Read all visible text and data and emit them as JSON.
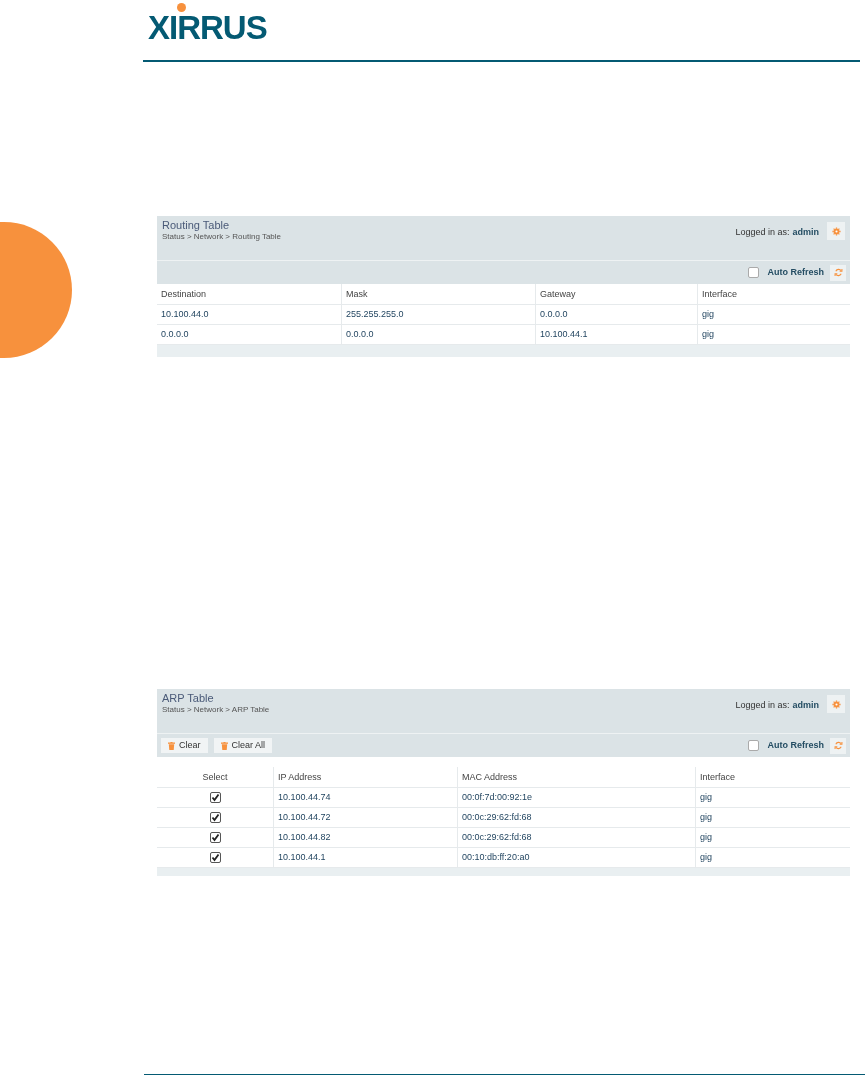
{
  "logo": {
    "text": "XIRRUS"
  },
  "panels": [
    {
      "title": "Routing Table",
      "breadcrumb": "Status > Network > Routing Table",
      "login_label": "Logged in as:",
      "user": "admin",
      "auto_refresh": {
        "label": "Auto Refresh",
        "checked": false
      },
      "columns": [
        "Destination",
        "Mask",
        "Gateway",
        "Interface"
      ],
      "rows": [
        {
          "cells": [
            "10.100.44.0",
            "255.255.255.0",
            "0.0.0.0",
            "gig"
          ]
        },
        {
          "cells": [
            "0.0.0.0",
            "0.0.0.0",
            "10.100.44.1",
            "gig"
          ]
        }
      ]
    },
    {
      "title": "ARP Table",
      "breadcrumb": "Status > Network > ARP Table",
      "login_label": "Logged in as:",
      "user": "admin",
      "buttons": [
        "Clear",
        "Clear All"
      ],
      "auto_refresh": {
        "label": "Auto Refresh",
        "checked": false
      },
      "columns": [
        "Select",
        "IP Address",
        "MAC Address",
        "Interface"
      ],
      "rows": [
        {
          "checked": true,
          "cells": [
            "",
            "10.100.44.74",
            "00:0f:7d:00:92:1e",
            "gig"
          ]
        },
        {
          "checked": true,
          "cells": [
            "",
            "10.100.44.72",
            "00:0c:29:62:fd:68",
            "gig"
          ]
        },
        {
          "checked": true,
          "cells": [
            "",
            "10.100.44.82",
            "00:0c:29:62:fd:68",
            "gig"
          ]
        },
        {
          "checked": true,
          "cells": [
            "",
            "10.100.44.1",
            "00:10:db:ff:20:a0",
            "gig"
          ]
        }
      ]
    }
  ]
}
